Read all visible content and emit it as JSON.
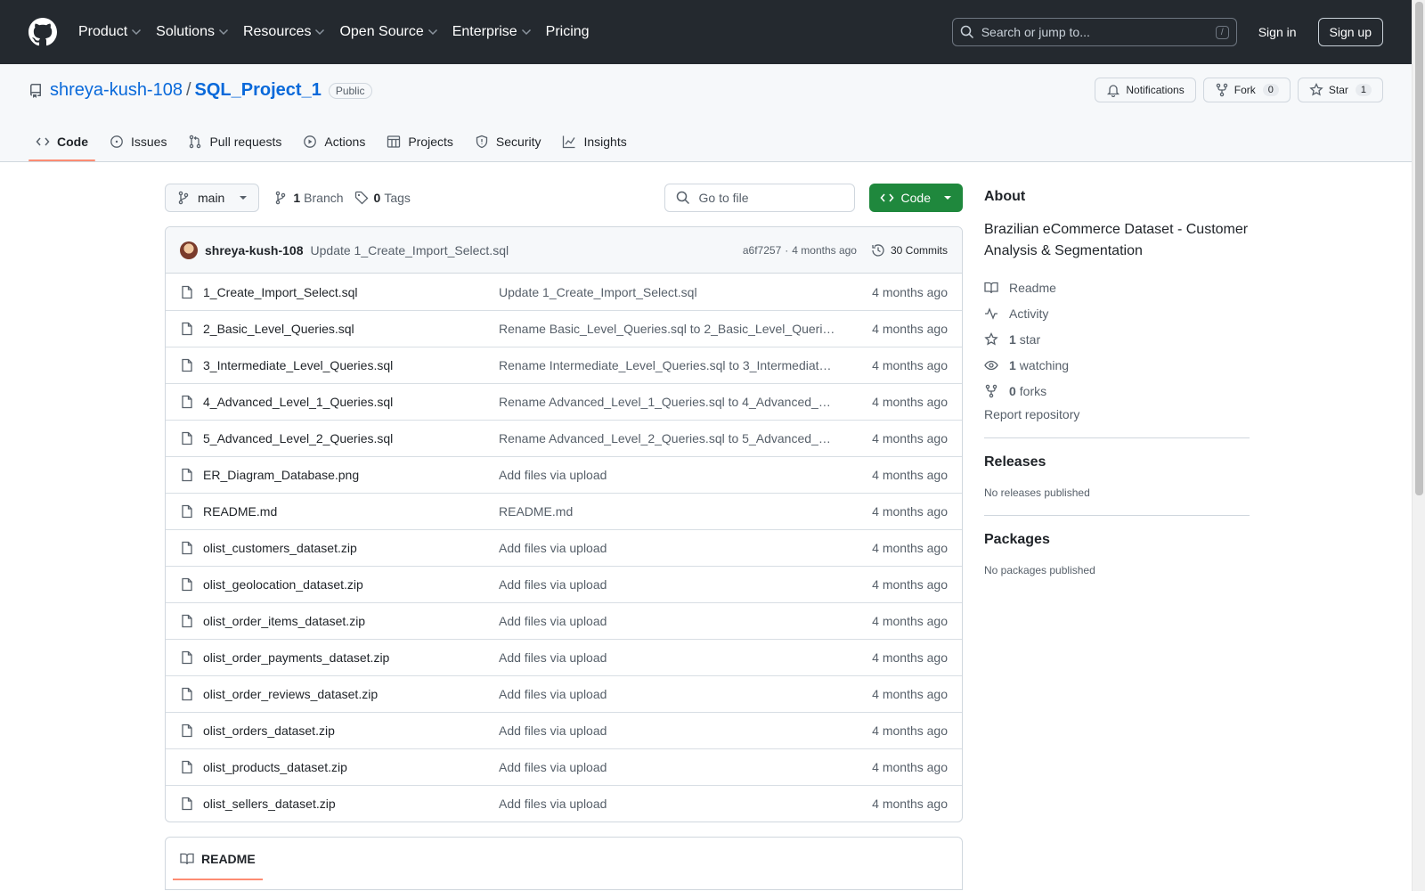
{
  "header": {
    "nav": [
      {
        "label": "Product",
        "dropdown": true
      },
      {
        "label": "Solutions",
        "dropdown": true
      },
      {
        "label": "Resources",
        "dropdown": true
      },
      {
        "label": "Open Source",
        "dropdown": true
      },
      {
        "label": "Enterprise",
        "dropdown": true
      },
      {
        "label": "Pricing",
        "dropdown": false
      }
    ],
    "search_placeholder": "Search or jump to...",
    "search_shortcut": "/",
    "signin": "Sign in",
    "signup": "Sign up"
  },
  "repo": {
    "owner": "shreya-kush-108",
    "separator": "/",
    "name": "SQL_Project_1",
    "visibility": "Public",
    "actions": {
      "notifications": "Notifications",
      "fork": "Fork",
      "fork_count": "0",
      "star": "Star",
      "star_count": "1"
    },
    "tabs": [
      "Code",
      "Issues",
      "Pull requests",
      "Actions",
      "Projects",
      "Security",
      "Insights"
    ],
    "active_tab": "Code"
  },
  "toolbar": {
    "branch": "main",
    "branch_count": "1",
    "branch_label": "Branch",
    "tag_count": "0",
    "tag_label": "Tags",
    "goto_placeholder": "Go to file",
    "code_label": "Code"
  },
  "commit": {
    "author": "shreya-kush-108",
    "message": "Update 1_Create_Import_Select.sql",
    "sha": "a6f7257",
    "dot": "·",
    "time": "4 months ago",
    "count_label": "30 Commits"
  },
  "files": [
    {
      "name": "1_Create_Import_Select.sql",
      "message": "Update 1_Create_Import_Select.sql",
      "date": "4 months ago"
    },
    {
      "name": "2_Basic_Level_Queries.sql",
      "message": "Rename Basic_Level_Queries.sql to 2_Basic_Level_Queri…",
      "date": "4 months ago"
    },
    {
      "name": "3_Intermediate_Level_Queries.sql",
      "message": "Rename Intermediate_Level_Queries.sql to 3_Intermediate…",
      "date": "4 months ago"
    },
    {
      "name": "4_Advanced_Level_1_Queries.sql",
      "message": "Rename Advanced_Level_1_Queries.sql to 4_Advanced_L…",
      "date": "4 months ago"
    },
    {
      "name": "5_Advanced_Level_2_Queries.sql",
      "message": "Rename Advanced_Level_2_Queries.sql to 5_Advanced_L…",
      "date": "4 months ago"
    },
    {
      "name": "ER_Diagram_Database.png",
      "message": "Add files via upload",
      "date": "4 months ago"
    },
    {
      "name": "README.md",
      "message": "README.md",
      "date": "4 months ago"
    },
    {
      "name": "olist_customers_dataset.zip",
      "message": "Add files via upload",
      "date": "4 months ago"
    },
    {
      "name": "olist_geolocation_dataset.zip",
      "message": "Add files via upload",
      "date": "4 months ago"
    },
    {
      "name": "olist_order_items_dataset.zip",
      "message": "Add files via upload",
      "date": "4 months ago"
    },
    {
      "name": "olist_order_payments_dataset.zip",
      "message": "Add files via upload",
      "date": "4 months ago"
    },
    {
      "name": "olist_order_reviews_dataset.zip",
      "message": "Add files via upload",
      "date": "4 months ago"
    },
    {
      "name": "olist_orders_dataset.zip",
      "message": "Add files via upload",
      "date": "4 months ago"
    },
    {
      "name": "olist_products_dataset.zip",
      "message": "Add files via upload",
      "date": "4 months ago"
    },
    {
      "name": "olist_sellers_dataset.zip",
      "message": "Add files via upload",
      "date": "4 months ago"
    }
  ],
  "readme": {
    "tab_label": "README"
  },
  "sidebar": {
    "about_title": "About",
    "description": "Brazilian eCommerce Dataset - Customer Analysis & Segmentation",
    "readme": "Readme",
    "activity": "Activity",
    "stars_count": "1",
    "stars_label": "star",
    "watching_count": "1",
    "watching_label": "watching",
    "forks_count": "0",
    "forks_label": "forks",
    "report": "Report repository",
    "releases_title": "Releases",
    "releases_empty": "No releases published",
    "packages_title": "Packages",
    "packages_empty": "No packages published"
  },
  "colors": {
    "header_bg": "#24292f",
    "link": "#0969da",
    "code_button": "#1f883d",
    "active_tab_underline": "#fd8c73"
  }
}
